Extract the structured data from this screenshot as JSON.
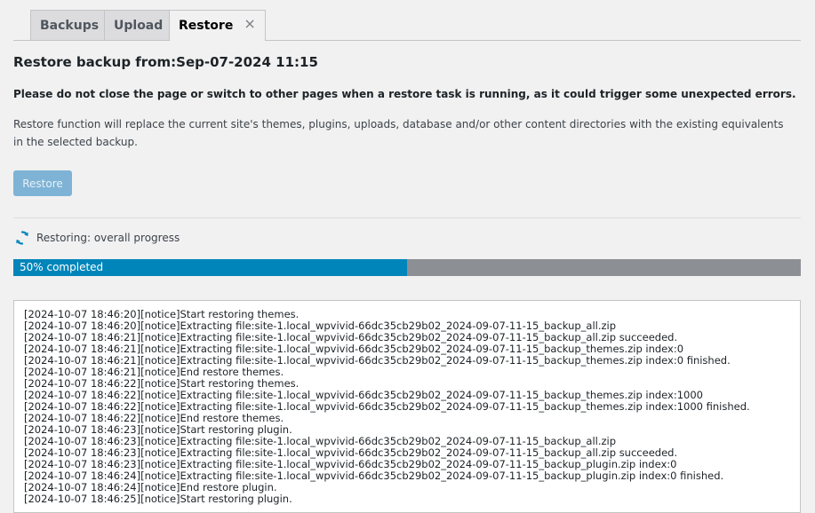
{
  "tabs": [
    {
      "label": "Backups"
    },
    {
      "label": "Upload"
    },
    {
      "label": "Restore",
      "close": "×"
    }
  ],
  "title": "Restore backup from:Sep-07-2024 11:15",
  "warning": "Please do not close the page or switch to other pages when a restore task is running, as it could trigger some unexpected errors.",
  "description": "Restore function will replace the current site's themes, plugins, uploads, database and/or other content directories with the existing equivalents in the selected backup.",
  "restore_button": "Restore",
  "progress": {
    "label": "Restoring: overall progress",
    "percent": 50,
    "text": "50% completed"
  },
  "log": [
    "[2024-10-07 18:46:20][notice]Start restoring themes.",
    "[2024-10-07 18:46:20][notice]Extracting file:site-1.local_wpvivid-66dc35cb29b02_2024-09-07-11-15_backup_all.zip",
    "[2024-10-07 18:46:21][notice]Extracting file:site-1.local_wpvivid-66dc35cb29b02_2024-09-07-11-15_backup_all.zip succeeded.",
    "[2024-10-07 18:46:21][notice]Extracting file:site-1.local_wpvivid-66dc35cb29b02_2024-09-07-11-15_backup_themes.zip index:0",
    "[2024-10-07 18:46:21][notice]Extracting file:site-1.local_wpvivid-66dc35cb29b02_2024-09-07-11-15_backup_themes.zip index:0 finished.",
    "[2024-10-07 18:46:21][notice]End restore themes.",
    "[2024-10-07 18:46:22][notice]Start restoring themes.",
    "[2024-10-07 18:46:22][notice]Extracting file:site-1.local_wpvivid-66dc35cb29b02_2024-09-07-11-15_backup_themes.zip index:1000",
    "[2024-10-07 18:46:22][notice]Extracting file:site-1.local_wpvivid-66dc35cb29b02_2024-09-07-11-15_backup_themes.zip index:1000 finished.",
    "[2024-10-07 18:46:22][notice]End restore themes.",
    "[2024-10-07 18:46:23][notice]Start restoring plugin.",
    "[2024-10-07 18:46:23][notice]Extracting file:site-1.local_wpvivid-66dc35cb29b02_2024-09-07-11-15_backup_all.zip",
    "[2024-10-07 18:46:23][notice]Extracting file:site-1.local_wpvivid-66dc35cb29b02_2024-09-07-11-15_backup_all.zip succeeded.",
    "[2024-10-07 18:46:23][notice]Extracting file:site-1.local_wpvivid-66dc35cb29b02_2024-09-07-11-15_backup_plugin.zip index:0",
    "[2024-10-07 18:46:24][notice]Extracting file:site-1.local_wpvivid-66dc35cb29b02_2024-09-07-11-15_backup_plugin.zip index:0 finished.",
    "[2024-10-07 18:46:24][notice]End restore plugin.",
    "[2024-10-07 18:46:25][notice]Start restoring plugin."
  ],
  "icons": {
    "progress": "sync-icon",
    "close": "close-icon"
  },
  "colors": {
    "accent": "#0085ba",
    "track": "#8c8f94",
    "button": "#7eb3d6"
  }
}
